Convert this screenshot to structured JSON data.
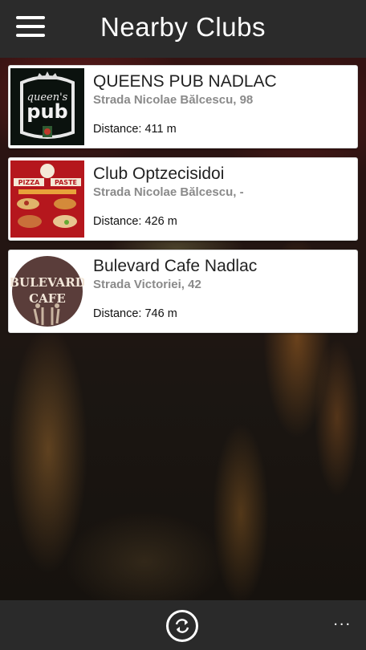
{
  "header": {
    "title": "Nearby Clubs",
    "menu_icon": "hamburger-menu-icon"
  },
  "clubs": [
    {
      "name": "QUEENS PUB NADLAC",
      "address": "Strada Nicolae Bălcescu, 98",
      "distance": "Distance: 411 m",
      "logo_text": "queen's pub"
    },
    {
      "name": "Club Optzecisidoi",
      "address": "Strada Nicolae Bălcescu, -",
      "distance": "Distance: 426 m",
      "logo_text": "PIZZA PASTE"
    },
    {
      "name": "Bulevard Cafe Nadlac",
      "address": "Strada Victoriei, 42",
      "distance": "Distance: 746 m",
      "logo_text": "BULEVARD CAFE"
    }
  ],
  "appbar": {
    "refresh_icon": "refresh-icon",
    "more_label": "..."
  },
  "colors": {
    "header_bg": "#2b2b2b",
    "appbar_bg": "#2a2a2a",
    "card_bg": "#ffffff",
    "address_color": "#8a8a8a"
  }
}
